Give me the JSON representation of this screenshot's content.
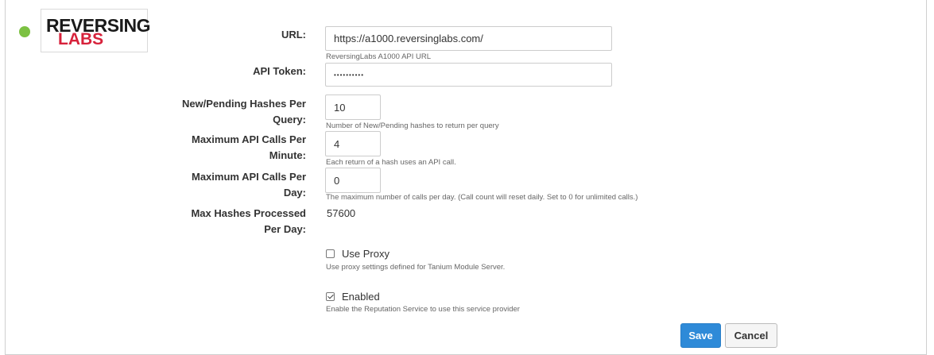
{
  "brand": {
    "logo_line1": "REVERSING",
    "logo_line2": "LABS",
    "status_color": "#7cc142"
  },
  "fields": {
    "url": {
      "label": "URL:",
      "value": "https://a1000.reversinglabs.com/",
      "help": "ReversingLabs A1000 API URL"
    },
    "api_token": {
      "label": "API Token:",
      "value": "••••••••••"
    },
    "new_pending": {
      "label_line1": "New/Pending Hashes Per",
      "label_line2": "Query:",
      "value": "10",
      "help": "Number of New/Pending hashes to return per query"
    },
    "max_per_minute": {
      "label_line1": "Maximum API Calls Per",
      "label_line2": "Minute:",
      "value": "4",
      "help": "Each return of a hash uses an API call."
    },
    "max_per_day": {
      "label_line1": "Maximum API Calls Per",
      "label_line2": "Day:",
      "value": "0",
      "help": "The maximum number of calls per day. (Call count will reset daily. Set to 0 for unlimited calls.)"
    },
    "max_hashes": {
      "label_line1": "Max Hashes Processed",
      "label_line2": "Per Day:",
      "value": "57600"
    }
  },
  "checkboxes": {
    "use_proxy": {
      "label": "Use Proxy",
      "checked": false,
      "help": "Use proxy settings defined for Tanium Module Server."
    },
    "enabled": {
      "label": "Enabled",
      "checked": true,
      "help": "Enable the Reputation Service to use this service provider"
    }
  },
  "buttons": {
    "save": "Save",
    "cancel": "Cancel"
  }
}
